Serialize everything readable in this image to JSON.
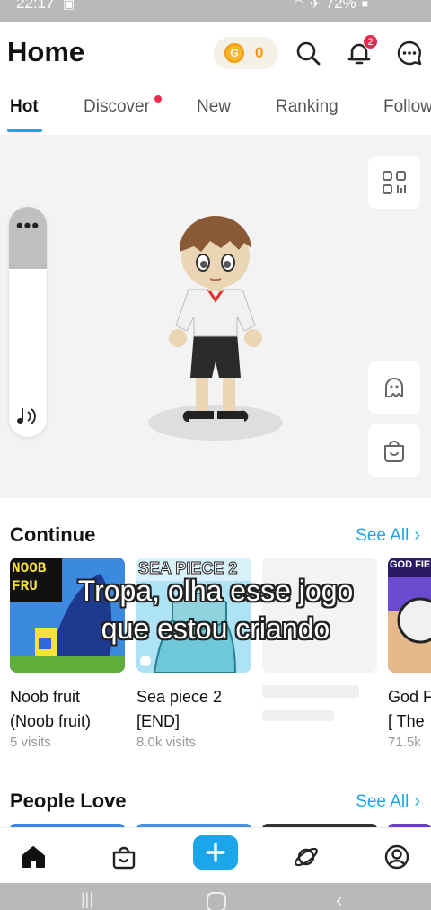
{
  "status_bar": {
    "time": "22:17",
    "battery": "72%"
  },
  "header": {
    "title": "Home",
    "coins": "0",
    "notifications_count": "2",
    "icons": [
      "search-icon",
      "bell-icon",
      "chat-icon"
    ]
  },
  "tabs": [
    {
      "label": "Hot",
      "active": true
    },
    {
      "label": "Discover",
      "has_dot": true
    },
    {
      "label": "New"
    },
    {
      "label": "Ranking"
    },
    {
      "label": "Follow"
    }
  ],
  "stage": {
    "volume_menu": "•••",
    "volume_level": 0.73,
    "side_buttons": [
      "qr-scan-icon",
      "ghost-icon",
      "shop-bag-icon"
    ]
  },
  "continue": {
    "title": "Continue",
    "see_all": "See All",
    "games": [
      {
        "name": "Noob fruit\n(Noob fruit)",
        "name_line1": "Noob fruit",
        "name_line2": "(Noob fruit)",
        "visits": "5 visits",
        "thumb_text": "NOOB FRU"
      },
      {
        "name_line1": "Sea piece 2",
        "name_line2": "[END]",
        "visits": "8.0k visits",
        "thumb_text": "SEA PIECE 2"
      },
      {
        "name_line1": "",
        "name_line2": "",
        "visits": ""
      },
      {
        "name_line1": "God F",
        "name_line2": "[ The",
        "visits": "71.5k",
        "thumb_text": "GOD FIE"
      }
    ]
  },
  "people_love": {
    "title": "People Love",
    "see_all": "See All"
  },
  "caption": {
    "line1": "Tropa, olha esse jogo",
    "line2": "que estou criando"
  },
  "bottom_nav": [
    "home-icon",
    "shop-bag-icon",
    "create-plus-icon",
    "planet-icon",
    "profile-icon"
  ],
  "colors": {
    "accent": "#1aa6e8",
    "badge": "#ea2b4f",
    "coin": "#f7b52a"
  }
}
